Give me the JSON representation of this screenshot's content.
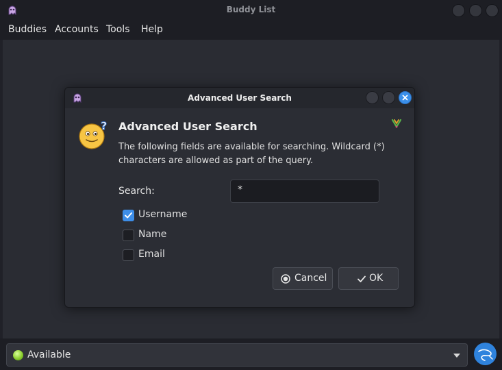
{
  "window": {
    "title": "Buddy List"
  },
  "menu": {
    "items": [
      "Buddies",
      "Accounts",
      "Tools",
      "Help"
    ]
  },
  "status": {
    "label": "Available",
    "color": "#8ccf2e"
  },
  "dialog": {
    "title": "Advanced User Search",
    "heading": "Advanced User Search",
    "description": "The following fields are available for searching. Wildcard (*) characters are allowed as part of the query.",
    "search_label": "Search:",
    "search_value": "*",
    "fields": [
      {
        "label": "Username",
        "checked": true
      },
      {
        "label": "Name",
        "checked": false
      },
      {
        "label": "Email",
        "checked": false
      }
    ],
    "cancel_label": "Cancel",
    "ok_label": "OK"
  },
  "colors": {
    "accent": "#3d8ee9",
    "background": "#2a2c33"
  }
}
